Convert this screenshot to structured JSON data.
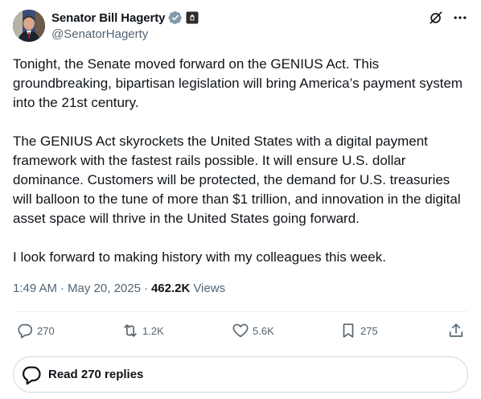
{
  "author": {
    "display_name": "Senator Bill Hagerty",
    "handle": "@SenatorHagerty",
    "verified_badge": "blue-verified-badge-icon",
    "affiliation_badge": "us-government-badge-icon",
    "verified_color": "#829aab"
  },
  "post": {
    "paragraphs": [
      "Tonight, the Senate moved forward on the GENIUS Act. This groundbreaking, bipartisan legislation will bring America’s payment system into the 21st century.",
      "The GENIUS Act skyrockets the United States with a digital payment framework with the fastest rails possible. It will ensure U.S. dollar dominance. Customers will be protected, the demand for U.S. treasuries will balloon to the tune of more than $1 trillion, and innovation in the digital asset space will thrive in the United States going forward.",
      "I look forward to making history with my colleagues this week."
    ],
    "time": "1:49 AM",
    "date": "May 20, 2025",
    "views_count": "462.2K",
    "views_label": "Views"
  },
  "actions": {
    "replies": "270",
    "reposts": "1.2K",
    "likes": "5.6K",
    "bookmarks": "275"
  },
  "read_replies_label": "Read 270 replies",
  "top_icons": [
    "grok-icon",
    "more-icon"
  ],
  "colors": {
    "text_primary": "#0f1419",
    "text_secondary": "#536471",
    "border": "#cfd9de",
    "divider": "#eff3f4"
  }
}
